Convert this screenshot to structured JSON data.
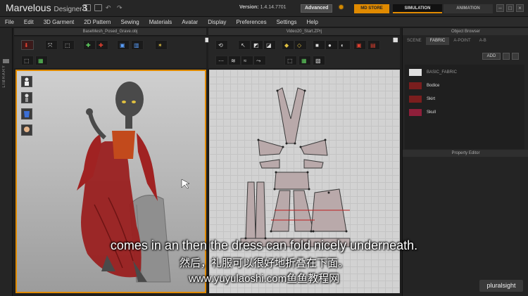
{
  "titlebar": {
    "app_name": "Marvelous",
    "app_sub": "Designer",
    "app_version_num": "3",
    "version_label": "Version:",
    "version_value": "1.4.14.7701",
    "advanced_label": "Advanced",
    "mdstore_label": "MD STORE",
    "simulation_label": "SIMULATION",
    "animation_label": "ANIMATION"
  },
  "menu": [
    "File",
    "Edit",
    "3D Garment",
    "2D Pattern",
    "Sewing",
    "Materials",
    "Avatar",
    "Display",
    "Preferences",
    "Settings",
    "Help"
  ],
  "rail": {
    "label": "LIBRARY"
  },
  "panels": {
    "view3d_title": "BaseMesh_Posed_Grave.obj",
    "view2d_title": "Video20_Start.ZPrj"
  },
  "object_browser": {
    "title": "Object Browser",
    "tabs": [
      "SCENE",
      "FABRIC",
      "A-POINT",
      "A-B"
    ],
    "active_tab": "FABRIC",
    "add_label": "ADD",
    "fabrics": [
      {
        "name": "BASIC_FABRIC",
        "color": "#e0e0e0"
      },
      {
        "name": "Bodice",
        "color": "#7a1e1e"
      },
      {
        "name": "Skirt",
        "color": "#7a1e1e"
      },
      {
        "name": "Skull",
        "color": "#8e1f3a"
      }
    ]
  },
  "property_editor": {
    "title": "Property Editor"
  },
  "subtitles": {
    "english": "comes in an then the dress can fold nicely underneath.",
    "chinese": "然后，礼服可以很好地折叠在下面。",
    "url": "www.yuyulaoshi.com鱼鱼教程网"
  },
  "watermark": "pluralsight",
  "colors": {
    "accent": "#e08a00",
    "fabric_red": "#9a2020"
  }
}
